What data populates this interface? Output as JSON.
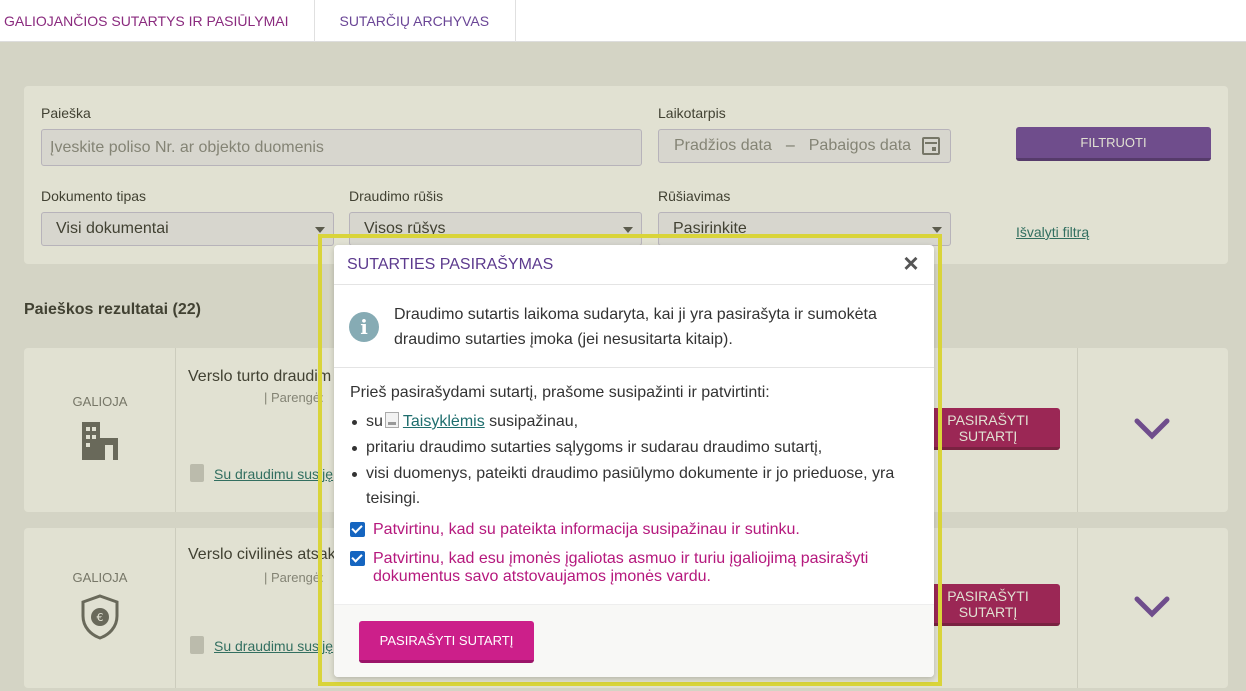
{
  "tabs": [
    {
      "label": "GALIOJANČIOS SUTARTYS IR PASIŪLYMAI"
    },
    {
      "label": "SUTARČIŲ ARCHYVAS"
    }
  ],
  "filter": {
    "search_label": "Paieška",
    "search_placeholder": "Įveskite poliso Nr. ar objekto duomenis",
    "period_label": "Laikotarpis",
    "start_placeholder": "Pradžios data",
    "date_separator": "–",
    "end_placeholder": "Pabaigos data",
    "filter_button": "FILTRUOTI",
    "doc_type_label": "Dokumento tipas",
    "doc_type_value": "Visi dokumentai",
    "ins_type_label": "Draudimo rūšis",
    "ins_type_value": "Visos rūšys",
    "sort_label": "Rūšiavimas",
    "sort_value": "Pasirinkite",
    "clear_link": "Išvalyti filtrą"
  },
  "results": {
    "title": "Paieškos rezultatai (22)",
    "cards": [
      {
        "status": "GALIOJA",
        "title": "Verslo turto draudim",
        "sub": "| Parengė:",
        "doc_link": "Su draudimu susiję",
        "sign_button": "PASIRAŠYTI SUTARTĮ"
      },
      {
        "status": "GALIOJA",
        "title": "Verslo civilinės atsak",
        "sub": "| Parengė:",
        "doc_link": "Su draudimu susiję",
        "sign_button": "PASIRAŠYTI SUTARTĮ"
      }
    ]
  },
  "modal": {
    "title": "SUTARTIES PASIRAŠYMAS",
    "info": "Draudimo sutartis laikoma sudaryta, kai ji yra pasirašyta ir sumokėta draudimo sutarties įmoka (jei nesusitarta kitaip).",
    "intro": "Prieš pasirašydami sutartį, prašome susipažinti ir patvirtinti:",
    "bullet1_prefix": "su",
    "bullet1_link": "Taisyklėmis",
    "bullet1_suffix": "susipažinau,",
    "bullet2": "pritariu draudimo sutarties sąlygoms ir sudarau draudimo sutartį,",
    "bullet3": "visi duomenys, pateikti draudimo pasiūlymo dokumente ir jo prieduose, yra teisingi.",
    "check1": "Patvirtinu, kad su pateikta informacija susipažinau ir sutinku.",
    "check2": "Patvirtinu, kad esu įmonės įgaliotas asmuo ir turiu įgaliojimą pasirašyti dokumentus savo atstovaujamos įmonės vardu.",
    "sign_button": "PASIRAŠYTI SUTARTĮ"
  },
  "colors": {
    "accent_purple": "#6e42a6",
    "sign_magenta": "#cc1f8a",
    "check_text": "#b5187d",
    "highlight_frame": "#d9d43a"
  }
}
